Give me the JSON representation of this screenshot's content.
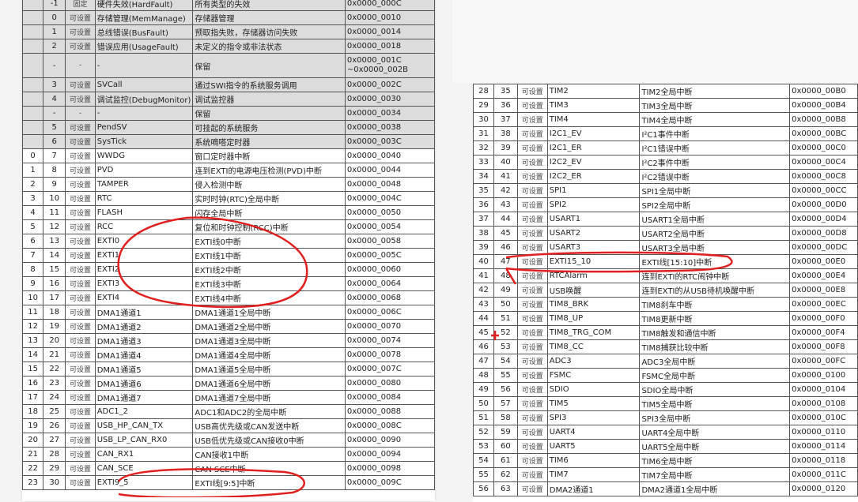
{
  "left_table": {
    "rows": [
      [
        "",
        "-1",
        "固定",
        "硬件失效(HardFault)",
        "所有类型的失效",
        "0x0000_000C",
        "sys"
      ],
      [
        "",
        "0",
        "可设置",
        "存储管理(MemManage)",
        "存储器管理",
        "0x0000_0010",
        "sys"
      ],
      [
        "",
        "1",
        "可设置",
        "总线错误(BusFault)",
        "预取指失败，存储器访问失败",
        "0x0000_0014",
        "sys"
      ],
      [
        "",
        "2",
        "可设置",
        "错误应用(UsageFault)",
        "未定义的指令或非法状态",
        "0x0000_0018",
        "sys"
      ],
      [
        "",
        "-",
        "-",
        "-",
        "保留",
        "0x0000_001C\n~0x0000_002B",
        "tall"
      ],
      [
        "",
        "3",
        "可设置",
        "SVCall",
        "通过SWI指令的系统服务调用",
        "0x0000_002C",
        "sys"
      ],
      [
        "",
        "4",
        "可设置",
        "调试监控(DebugMonitor)",
        "调试监控器",
        "0x0000_0030",
        "sys"
      ],
      [
        "",
        "-",
        "-",
        "-",
        "保留",
        "0x0000_0034",
        "sys"
      ],
      [
        "",
        "5",
        "可设置",
        "PendSV",
        "可挂起的系统服务",
        "0x0000_0038",
        "sys"
      ],
      [
        "",
        "6",
        "可设置",
        "SysTick",
        "系统嘀嗒定时器",
        "0x0000_003C",
        "sys"
      ],
      [
        "0",
        "7",
        "可设置",
        "WWDG",
        "窗口定时器中断",
        "0x0000_0040",
        ""
      ],
      [
        "1",
        "8",
        "可设置",
        "PVD",
        "连到EXTI的电源电压检测(PVD)中断",
        "0x0000_0044",
        ""
      ],
      [
        "2",
        "9",
        "可设置",
        "TAMPER",
        "侵入检测中断",
        "0x0000_0048",
        ""
      ],
      [
        "3",
        "10",
        "可设置",
        "RTC",
        "实时时钟(RTC)全局中断",
        "0x0000_004C",
        ""
      ],
      [
        "4",
        "11",
        "可设置",
        "FLASH",
        "闪存全局中断",
        "0x0000_0050",
        ""
      ],
      [
        "5",
        "12",
        "可设置",
        "RCC",
        "复位和时钟控制(RCC)中断",
        "0x0000_0054",
        ""
      ],
      [
        "6",
        "13",
        "可设置",
        "EXTI0",
        "EXTI线0中断",
        "0x0000_0058",
        ""
      ],
      [
        "7",
        "14",
        "可设置",
        "EXTI1",
        "EXTI线1中断",
        "0x0000_005C",
        ""
      ],
      [
        "8",
        "15",
        "可设置",
        "EXTI2",
        "EXTI线2中断",
        "0x0000_0060",
        ""
      ],
      [
        "9",
        "16",
        "可设置",
        "EXTI3",
        "EXTI线3中断",
        "0x0000_0064",
        ""
      ],
      [
        "10",
        "17",
        "可设置",
        "EXTI4",
        "EXTI线4中断",
        "0x0000_0068",
        ""
      ],
      [
        "11",
        "18",
        "可设置",
        "DMA1通道1",
        "DMA1通道1全局中断",
        "0x0000_006C",
        ""
      ],
      [
        "12",
        "19",
        "可设置",
        "DMA1通道2",
        "DMA1通道2全局中断",
        "0x0000_0070",
        ""
      ],
      [
        "13",
        "20",
        "可设置",
        "DMA1通道3",
        "DMA1通道3全局中断",
        "0x0000_0074",
        ""
      ],
      [
        "14",
        "21",
        "可设置",
        "DMA1通道4",
        "DMA1通道4全局中断",
        "0x0000_0078",
        ""
      ],
      [
        "15",
        "22",
        "可设置",
        "DMA1通道5",
        "DMA1通道5全局中断",
        "0x0000_007C",
        ""
      ],
      [
        "16",
        "23",
        "可设置",
        "DMA1通道6",
        "DMA1通道6全局中断",
        "0x0000_0080",
        ""
      ],
      [
        "17",
        "24",
        "可设置",
        "DMA1通道7",
        "DMA1通道7全局中断",
        "0x0000_0084",
        ""
      ],
      [
        "18",
        "25",
        "可设置",
        "ADC1_2",
        "ADC1和ADC2的全局中断",
        "0x0000_0088",
        ""
      ],
      [
        "19",
        "26",
        "可设置",
        "USB_HP_CAN_TX",
        "USB高优先级或CAN发送中断",
        "0x0000_008C",
        ""
      ],
      [
        "20",
        "27",
        "可设置",
        "USB_LP_CAN_RX0",
        "USB低优先级或CAN接收0中断",
        "0x0000_0090",
        ""
      ],
      [
        "21",
        "28",
        "可设置",
        "CAN_RX1",
        "CAN接收1中断",
        "0x0000_0094",
        ""
      ],
      [
        "22",
        "29",
        "可设置",
        "CAN_SCE",
        "CAN SCE中断",
        "0x0000_0098",
        ""
      ],
      [
        "23",
        "30",
        "可设置",
        "EXTI9_5",
        "EXTI线[9:5]中断",
        "0x0000_009C",
        ""
      ]
    ]
  },
  "right_table": {
    "rows": [
      [
        "28",
        "35",
        "可设置",
        "TIM2",
        "TIM2全局中断",
        "0x0000_00B0"
      ],
      [
        "29",
        "36",
        "可设置",
        "TIM3",
        "TIM3全局中断",
        "0x0000_00B4"
      ],
      [
        "30",
        "37",
        "可设置",
        "TIM4",
        "TIM4全局中断",
        "0x0000_00B8"
      ],
      [
        "31",
        "38",
        "可设置",
        "I2C1_EV",
        "I²C1事件中断",
        "0x0000_00BC"
      ],
      [
        "32",
        "39",
        "可设置",
        "I2C1_ER",
        "I²C1错误中断",
        "0x0000_00C0"
      ],
      [
        "33",
        "40",
        "可设置",
        "I2C2_EV",
        "I²C2事件中断",
        "0x0000_00C4"
      ],
      [
        "34",
        "41",
        "可设置",
        "I2C2_ER",
        "I²C2错误中断",
        "0x0000_00C8"
      ],
      [
        "35",
        "42",
        "可设置",
        "SPI1",
        "SPI1全局中断",
        "0x0000_00CC"
      ],
      [
        "36",
        "43",
        "可设置",
        "SPI2",
        "SPI2全局中断",
        "0x0000_00D0"
      ],
      [
        "37",
        "44",
        "可设置",
        "USART1",
        "USART1全局中断",
        "0x0000_00D4"
      ],
      [
        "38",
        "45",
        "可设置",
        "USART2",
        "USART2全局中断",
        "0x0000_00D8"
      ],
      [
        "39",
        "46",
        "可设置",
        "USART3",
        "USART3全局中断",
        "0x0000_00DC"
      ],
      [
        "40",
        "47",
        "可设置",
        "EXTI15_10",
        "EXTI线[15:10]中断",
        "0x0000_00E0"
      ],
      [
        "41",
        "48",
        "可设置",
        "RTCAlarm",
        "连到EXTI的RTC闹钟中断",
        "0x0000_00E4"
      ],
      [
        "42",
        "49",
        "可设置",
        "USB唤醒",
        "连到EXTI的从USB待机唤醒中断",
        "0x0000_00E8"
      ],
      [
        "43",
        "50",
        "可设置",
        "TIM8_BRK",
        "TIM8刹车中断",
        "0x0000_00EC"
      ],
      [
        "44",
        "51",
        "可设置",
        "TIM8_UP",
        "TIM8更新中断",
        "0x0000_00F0"
      ],
      [
        "45",
        "52",
        "可设置",
        "TIM8_TRG_COM",
        "TIM8触发和通信中断",
        "0x0000_00F4"
      ],
      [
        "46",
        "53",
        "可设置",
        "TIM8_CC",
        "TIM8捕获比较中断",
        "0x0000_00F8"
      ],
      [
        "47",
        "54",
        "可设置",
        "ADC3",
        "ADC3全局中断",
        "0x0000_00FC"
      ],
      [
        "48",
        "55",
        "可设置",
        "FSMC",
        "FSMC全局中断",
        "0x0000_0100"
      ],
      [
        "49",
        "56",
        "可设置",
        "SDIO",
        "SDIO全局中断",
        "0x0000_0104"
      ],
      [
        "50",
        "57",
        "可设置",
        "TIM5",
        "TIM5全局中断",
        "0x0000_0108"
      ],
      [
        "51",
        "58",
        "可设置",
        "SPI3",
        "SPI3全局中断",
        "0x0000_010C"
      ],
      [
        "52",
        "59",
        "可设置",
        "UART4",
        "UART4全局中断",
        "0x0000_0110"
      ],
      [
        "53",
        "60",
        "可设置",
        "UART5",
        "UART5全局中断",
        "0x0000_0114"
      ],
      [
        "54",
        "61",
        "可设置",
        "TIM6",
        "TIM6全局中断",
        "0x0000_0118"
      ],
      [
        "55",
        "62",
        "可设置",
        "TIM7",
        "TIM7全局中断",
        "0x0000_011C"
      ],
      [
        "56",
        "63",
        "可设置",
        "DMA2通道1",
        "DMA2通道1全局中断",
        "0x0000_0120"
      ]
    ]
  },
  "annotation_color": "#e02020"
}
